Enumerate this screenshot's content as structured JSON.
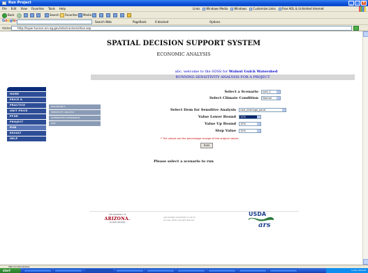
{
  "window": {
    "title": "Run Project"
  },
  "menu": {
    "items": [
      "File",
      "Edit",
      "View",
      "Favorites",
      "Tools",
      "Help"
    ],
    "links": [
      "Links",
      "Windows Media",
      "Windows",
      "Customize Links",
      "Free AOL & Unlimited Internet"
    ]
  },
  "toolbar": {
    "back": "Back",
    "search": "Search",
    "favorites": "Favorites",
    "media": "Media"
  },
  "google": {
    "logo": "Google",
    "search_web": "Search Web",
    "pagerank": "PageRank",
    "popups": "0 blocked",
    "options": "Options"
  },
  "address": {
    "label": "Address",
    "url": "http://tuper.tucson.ars.ag.gov/sdss/run/sensitive.asp"
  },
  "page": {
    "title": "SPATIAL DECISION SUPPORT SYSTEM",
    "subtitle": "ECONOMIC ANALYSIS",
    "welcome_user": "abc",
    "welcome_text": ", welcome to the SDSS for",
    "watershed": "Walnut Gulch Watershed",
    "banner": "RUNNING SENSITIVITY ANALYSIS FOR A PROJECT"
  },
  "nav": {
    "items": [
      "HOME",
      "PRICE &",
      "PRACTICE",
      "UNIT PRICE",
      "PFOR",
      "PROJECT",
      "RUN",
      "RESULT",
      "HELP"
    ]
  },
  "subnav": {
    "items": [
      "RUN PROJECT",
      "SENSITIVITY ANALYSIS",
      "ALTERNATIVE COMPARISON",
      "RUN"
    ]
  },
  "form": {
    "scenario_label": "Select a Scenario",
    "scenario_value": "sunt_1",
    "climate_label": "Select Climate Condition",
    "climate_value": "Normal",
    "item_label": "Select Item for Sensitive Analysis",
    "item_value": "cost_drainage_pond",
    "lower_label": "Value Lower Bound",
    "lower_value": "10%",
    "upper_label": "Value Up Bound",
    "upper_value": "10%",
    "step_label": "Step Value",
    "step_value": "10%",
    "note": "* The values are the percentage change of the original values",
    "run_button": "RUN",
    "hint": "Please select a scenario to run"
  },
  "footer": {
    "az_top": "THE UNIVERSITY OF",
    "az_name": "ARIZONA.",
    "az_bottom": "TUCSON ARIZONA",
    "text1": "Last Modified 01/02/2007 11:40:13",
    "text2": "All Copy. 2004 Copyright reserved",
    "usda": "USDA"
  },
  "status": {
    "text": "http://localhost/sdss"
  },
  "taskbar": {
    "start": "start",
    "tray": "Local intranet"
  }
}
